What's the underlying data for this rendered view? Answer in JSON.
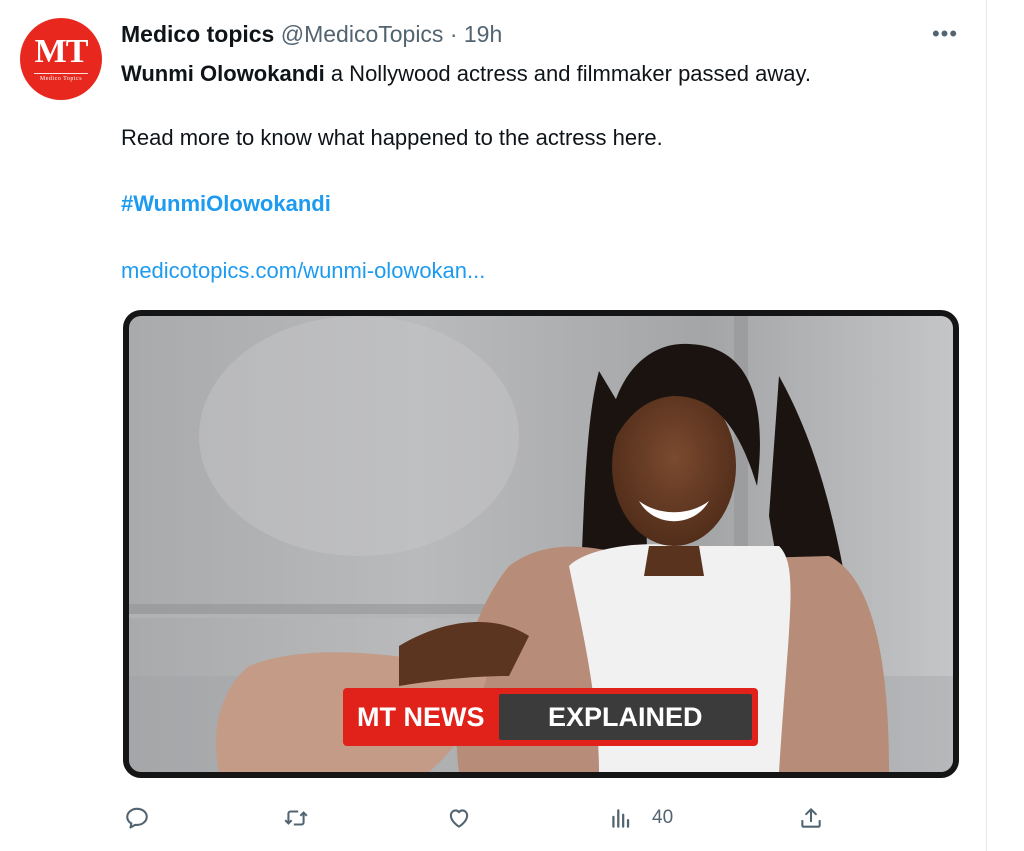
{
  "tweet": {
    "author_name": "Medico topics",
    "handle": "@MedicoTopics",
    "separator": "·",
    "time": "19h",
    "more_label": "•••",
    "avatar": {
      "monogram": "MT",
      "subtitle": "Medico Topics",
      "color": "#e8281f"
    },
    "text": {
      "mention": "Wunmi Olowokandi",
      "line1_rest": " a Nollywood actress and filmmaker passed away.",
      "line2": "Read more to know what happened to the actress here.",
      "hashtag": "#WunmiOlowokandi",
      "link": "medicotopics.com/wunmi-olowokan..."
    },
    "media": {
      "banner_left": "MT NEWS",
      "banner_right": "EXPLAINED",
      "banner_color": "#e0221a"
    },
    "actions": {
      "reply_icon": "reply-icon",
      "retweet_icon": "retweet-icon",
      "like_icon": "heart-icon",
      "views_icon": "views-bar-icon",
      "views_count": "40",
      "share_icon": "share-icon"
    },
    "colors": {
      "link": "#1d9bf0",
      "muted": "#536471"
    }
  }
}
